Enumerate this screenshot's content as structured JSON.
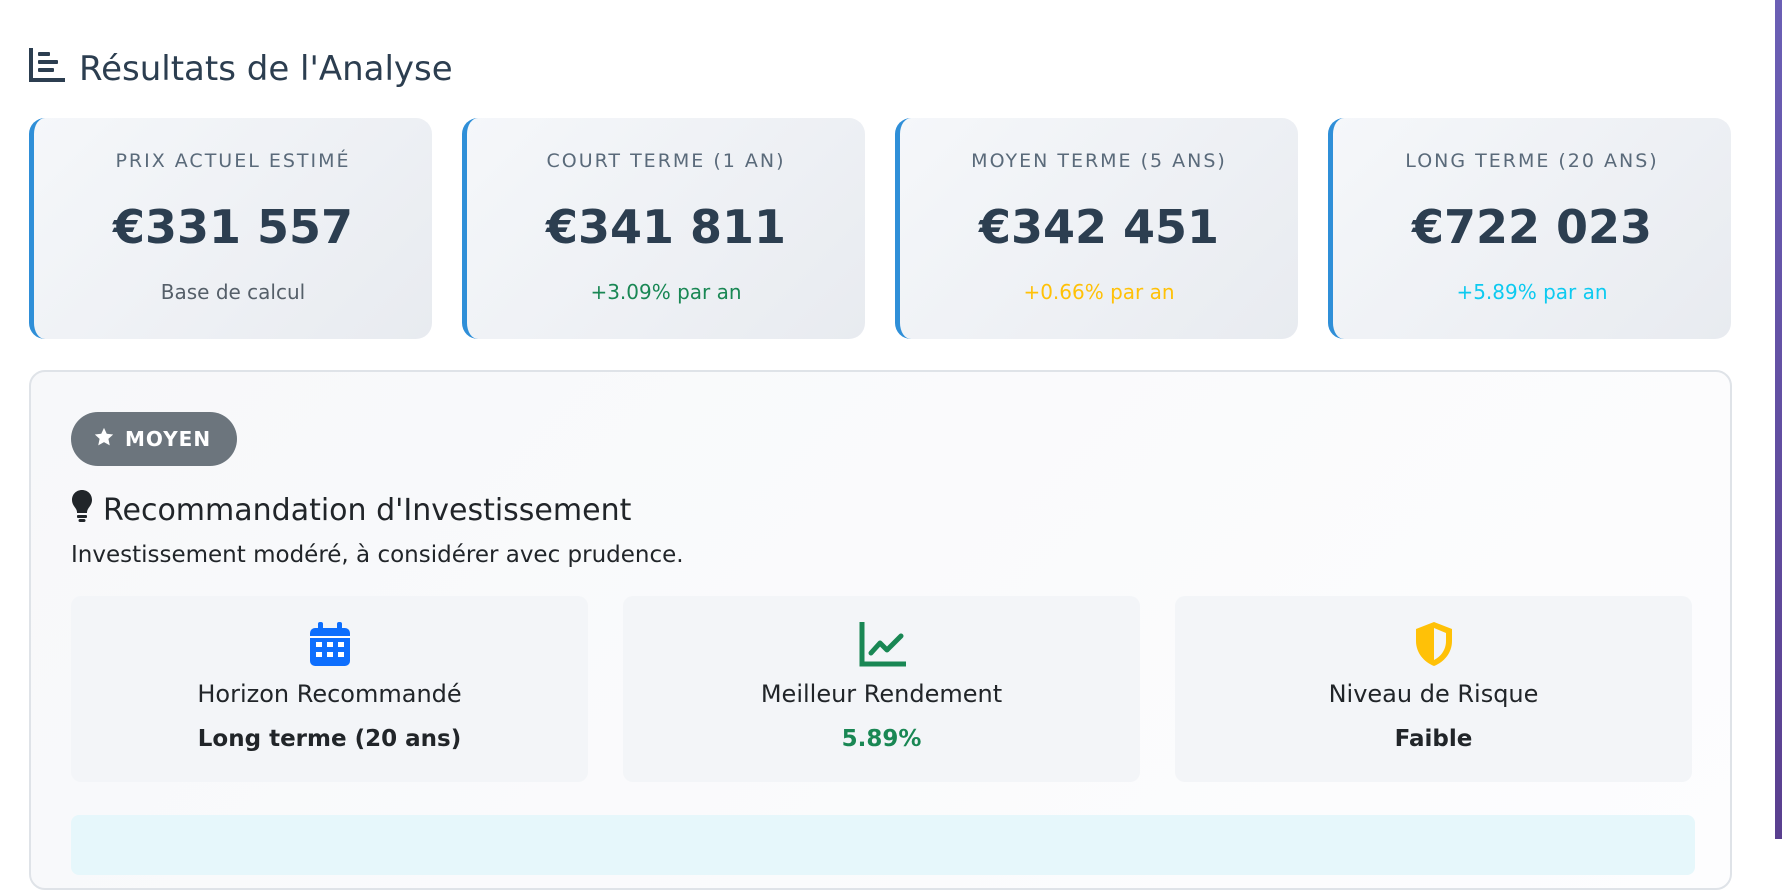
{
  "section": {
    "title": "Résultats de l'Analyse",
    "icon": "chart-bar-icon"
  },
  "cards": [
    {
      "label": "PRIX ACTUEL ESTIMÉ",
      "value": "€331 557",
      "sub": "Base de calcul",
      "sub_color": "#555f69"
    },
    {
      "label": "COURT TERME (1 AN)",
      "value": "€341 811",
      "sub": "+3.09% par an",
      "sub_color": "#198754"
    },
    {
      "label": "MOYEN TERME (5 ANS)",
      "value": "€342 451",
      "sub": "+0.66% par an",
      "sub_color": "#ffc107"
    },
    {
      "label": "LONG TERME (20 ANS)",
      "value": "€722 023",
      "sub": "+5.89% par an",
      "sub_color": "#0dcaf0"
    }
  ],
  "recommendation": {
    "badge": "MOYEN",
    "title": "Recommandation d'Investissement",
    "description": "Investissement modéré, à considérer avec prudence.",
    "metrics": [
      {
        "icon": "calendar-icon",
        "label": "Horizon Recommandé",
        "value": "Long terme (20 ans)",
        "value_color": "#212529",
        "icon_color": "#0d6efd"
      },
      {
        "icon": "chart-line-icon",
        "label": "Meilleur Rendement",
        "value": "5.89%",
        "value_color": "#198754",
        "icon_color": "#198754"
      },
      {
        "icon": "shield-icon",
        "label": "Niveau de Risque",
        "value": "Faible",
        "value_color": "#212529",
        "icon_color": "#ffc107"
      }
    ]
  },
  "colors": {
    "accent": "#2f8fd8",
    "badge_bg": "#6c757d",
    "info_bg": "#e6f7fb"
  }
}
